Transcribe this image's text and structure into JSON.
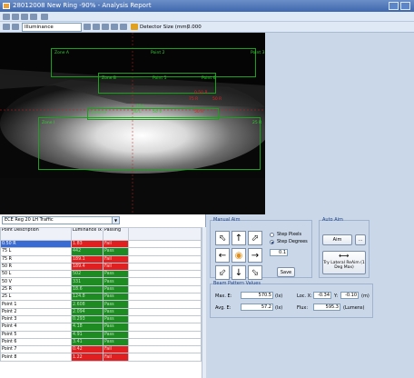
{
  "window": {
    "title": "28012008 New Ring -90% - Analysis Report"
  },
  "toolbar": {
    "measure_select": "Illuminance",
    "detector_label": "Detector Size (mm)",
    "detector_value": "0.000"
  },
  "image": {
    "zone_labels": {
      "zone_a": "Zone A",
      "point2": "Point 2",
      "point3": "Point 3",
      "zone_b": "Zone B",
      "point5": "Point 5",
      "point6": "Point 6",
      "p_50r_top": "0.50 R",
      "p_75r": "75 R",
      "p_50r": "50 R",
      "p_75l": "75 L",
      "p_50l": "50 L",
      "p_50v": "50 V",
      "p_50r2": "50 R",
      "zone_iv": "Zone IV",
      "zone_i": "Zone I",
      "p_25r": "25 R"
    }
  },
  "list": {
    "selector": "ECE Reg 20 LH Traffic",
    "headers": {
      "desc": "Point Description",
      "lum": "Luminance lx",
      "pass": "Passing"
    },
    "rows": [
      {
        "desc": "0.50 R",
        "lum": "1.83",
        "pass": "Fail",
        "status": "red"
      },
      {
        "desc": "75 L",
        "lum": "442",
        "pass": "Pass",
        "status": "green"
      },
      {
        "desc": "75 R",
        "lum": "189.1",
        "pass": "Fail",
        "status": "red"
      },
      {
        "desc": "50 R",
        "lum": "189.4",
        "pass": "Fail",
        "status": "red"
      },
      {
        "desc": "50 L",
        "lum": "502",
        "pass": "Pass",
        "status": "green"
      },
      {
        "desc": "50 V",
        "lum": "331",
        "pass": "Pass",
        "status": "green"
      },
      {
        "desc": "25 R",
        "lum": "18.6",
        "pass": "Pass",
        "status": "green"
      },
      {
        "desc": "25 L",
        "lum": "124.8",
        "pass": "Pass",
        "status": "green"
      },
      {
        "desc": "Point 1",
        "lum": "2.608",
        "pass": "Pass",
        "status": "green"
      },
      {
        "desc": "Point 2",
        "lum": "2.094",
        "pass": "Pass",
        "status": "green"
      },
      {
        "desc": "Point 3",
        "lum": "0.293",
        "pass": "Pass",
        "status": "green"
      },
      {
        "desc": "Point 4",
        "lum": "4.18",
        "pass": "Pass",
        "status": "green"
      },
      {
        "desc": "Point 5",
        "lum": "4.91",
        "pass": "Pass",
        "status": "green"
      },
      {
        "desc": "Point 6",
        "lum": "3.41",
        "pass": "Pass",
        "status": "green"
      },
      {
        "desc": "Point 7",
        "lum": "0.42",
        "pass": "Fail",
        "status": "red"
      },
      {
        "desc": "Point 8",
        "lum": "1.22",
        "pass": "Fail",
        "status": "red"
      }
    ]
  },
  "manual_aim": {
    "title": "Manual Aim",
    "step_pixels": "Step Pixels",
    "step_degrees": "Step Degrees",
    "step_value": "0.1",
    "save": "Save"
  },
  "auto_aim": {
    "title": "Auto Aim",
    "aim": "Aim",
    "more": "...",
    "try_lateral": "Try Lateral ReAim (1 Deg Max)"
  },
  "beam": {
    "title": "Beam Pattern Values",
    "max_e_label": "Max. E:",
    "max_e": "570.5",
    "avg_e_label": "Avg. E:",
    "avg_e": "57.2",
    "unit_lx": "(lx)",
    "loc_x_label": "Loc. X:",
    "loc_x": "-0.34",
    "y_label": "Y:",
    "y": "-0.10",
    "unit_m": "(m)",
    "flux_label": "Flux:",
    "flux": "595.3",
    "unit_lumens": "(Lumens)"
  }
}
